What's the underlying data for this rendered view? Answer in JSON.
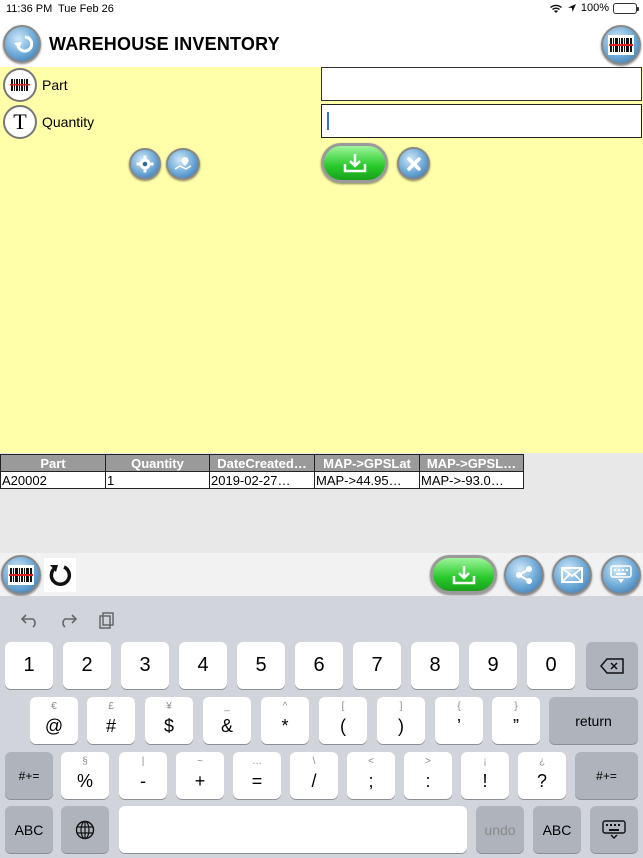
{
  "status_bar": {
    "time": "11:36 PM",
    "date": "Tue Feb 26",
    "battery": "100%"
  },
  "header": {
    "title": "WAREHOUSE INVENTORY"
  },
  "form": {
    "part_label": "Part",
    "part_value": "",
    "quantity_label": "Quantity",
    "quantity_value": ""
  },
  "table": {
    "columns": [
      "Part",
      "Quantity",
      "DateCreated…",
      "MAP->GPSLat",
      "MAP->GPSL…"
    ],
    "rows": [
      [
        "A20002",
        "1",
        "2019-02-27…",
        "MAP->44.95…",
        "MAP->-93.0…"
      ]
    ]
  },
  "keyboard": {
    "row1": [
      "1",
      "2",
      "3",
      "4",
      "5",
      "6",
      "7",
      "8",
      "9",
      "0"
    ],
    "row2": [
      {
        "hint": "€",
        "main": "@"
      },
      {
        "hint": "£",
        "main": "#"
      },
      {
        "hint": "¥",
        "main": "$"
      },
      {
        "hint": "_",
        "main": "&"
      },
      {
        "hint": "^",
        "main": "*"
      },
      {
        "hint": "[",
        "main": "("
      },
      {
        "hint": "]",
        "main": ")"
      },
      {
        "hint": "{",
        "main": "’"
      },
      {
        "hint": "}",
        "main": "”"
      }
    ],
    "row3": [
      {
        "hint": "§",
        "main": "%"
      },
      {
        "hint": "|",
        "main": "-"
      },
      {
        "hint": "~",
        "main": "+"
      },
      {
        "hint": "…",
        "main": "="
      },
      {
        "hint": "\\",
        "main": "/"
      },
      {
        "hint": "<",
        "main": ";"
      },
      {
        "hint": ">",
        "main": ":"
      },
      {
        "hint": "¡",
        "main": "!"
      },
      {
        "hint": "¿",
        "main": "?"
      }
    ],
    "return_label": "return",
    "shift_label": "#+=",
    "abc_label": "ABC",
    "undo_label": "undo"
  },
  "colors": {
    "form_bg": "#ffffaa",
    "header_bg": "#9a9a9a",
    "accent_green": "#27c92a",
    "accent_blue": "#2f6a9e"
  }
}
